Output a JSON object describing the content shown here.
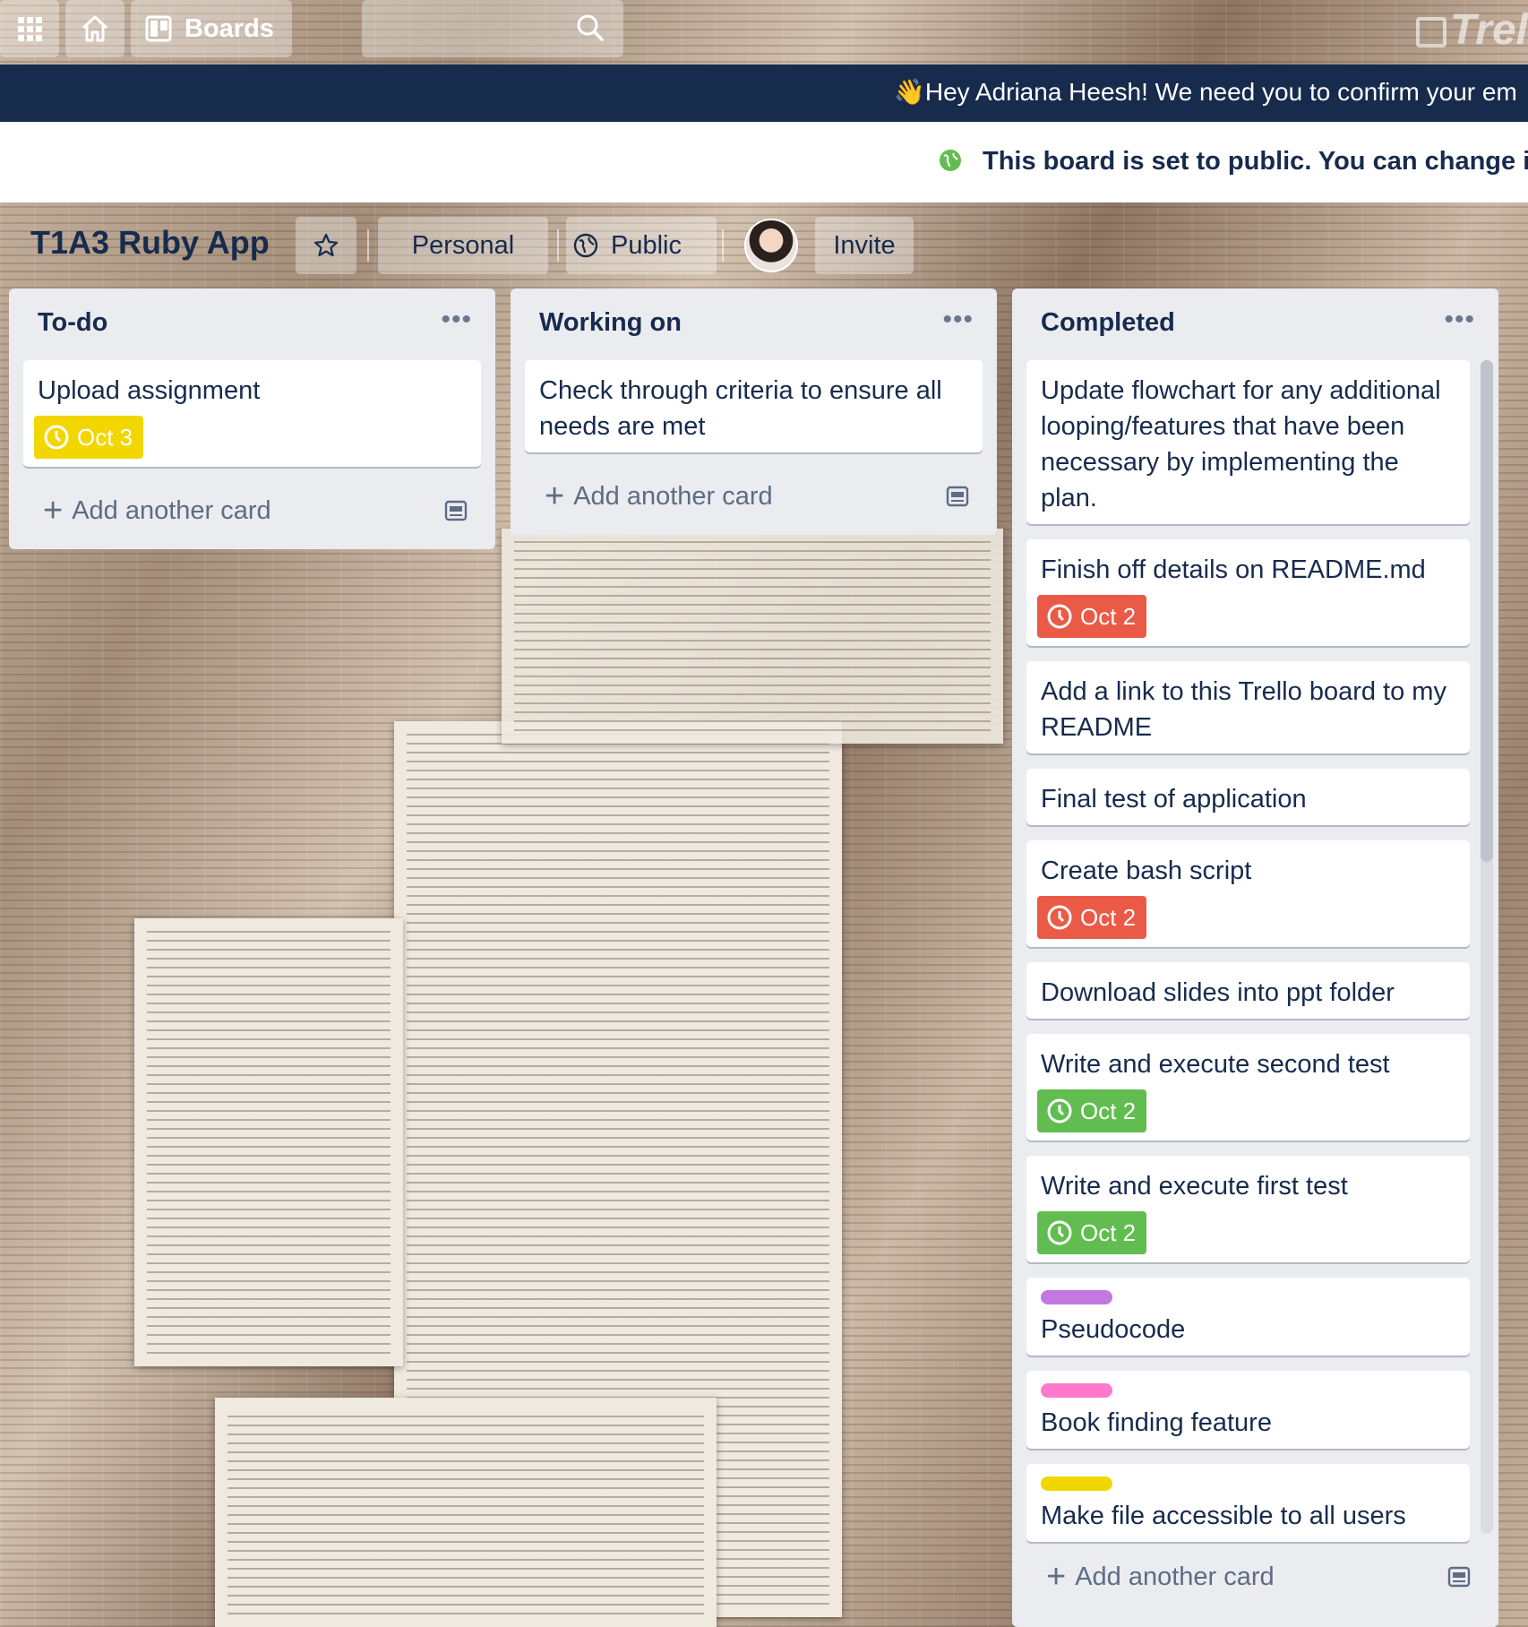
{
  "topbar": {
    "boards_label": "Boards",
    "logo_text": "Trel"
  },
  "banners": {
    "confirm": "👋Hey Adriana Heesh! We need you to confirm your em",
    "public_notice": "This board is set to public. You can change it"
  },
  "board": {
    "title": "T1A3 Ruby App",
    "team": "Personal",
    "visibility": "Public",
    "invite": "Invite"
  },
  "lists": [
    {
      "title": "To-do",
      "cards": [
        {
          "text": "Upload assignment",
          "due": "Oct 3",
          "due_color": "#f2d600"
        }
      ],
      "add_label": "Add another card"
    },
    {
      "title": "Working on",
      "cards": [
        {
          "text": "Check through criteria to ensure all needs are met"
        }
      ],
      "add_label": "Add another card"
    },
    {
      "title": "Completed",
      "cards": [
        {
          "text": "Update flowchart for any additional looping/features that have been necessary by implementing the plan."
        },
        {
          "text": "Finish off details on README.md",
          "due": "Oct 2",
          "due_color": "#eb5a46"
        },
        {
          "text": "Add a link to this Trello board to my README"
        },
        {
          "text": "Final test of application"
        },
        {
          "text": "Create bash script",
          "due": "Oct 2",
          "due_color": "#eb5a46"
        },
        {
          "text": "Download slides into ppt folder"
        },
        {
          "text": "Write and execute second test",
          "due": "Oct 2",
          "due_color": "#61bd4f"
        },
        {
          "text": "Write and execute first test",
          "due": "Oct 2",
          "due_color": "#61bd4f"
        },
        {
          "text": "Pseudocode",
          "label_color": "#c377e0"
        },
        {
          "text": "Book finding feature",
          "label_color": "#ff78cb"
        },
        {
          "text": "Make file accessible to all users",
          "label_color": "#f2d600"
        }
      ],
      "add_label": "Add another card"
    }
  ],
  "colors": {
    "header_dark": "#172b4d",
    "list_bg": "#ebecf0",
    "globe_green": "#61bd4f"
  }
}
